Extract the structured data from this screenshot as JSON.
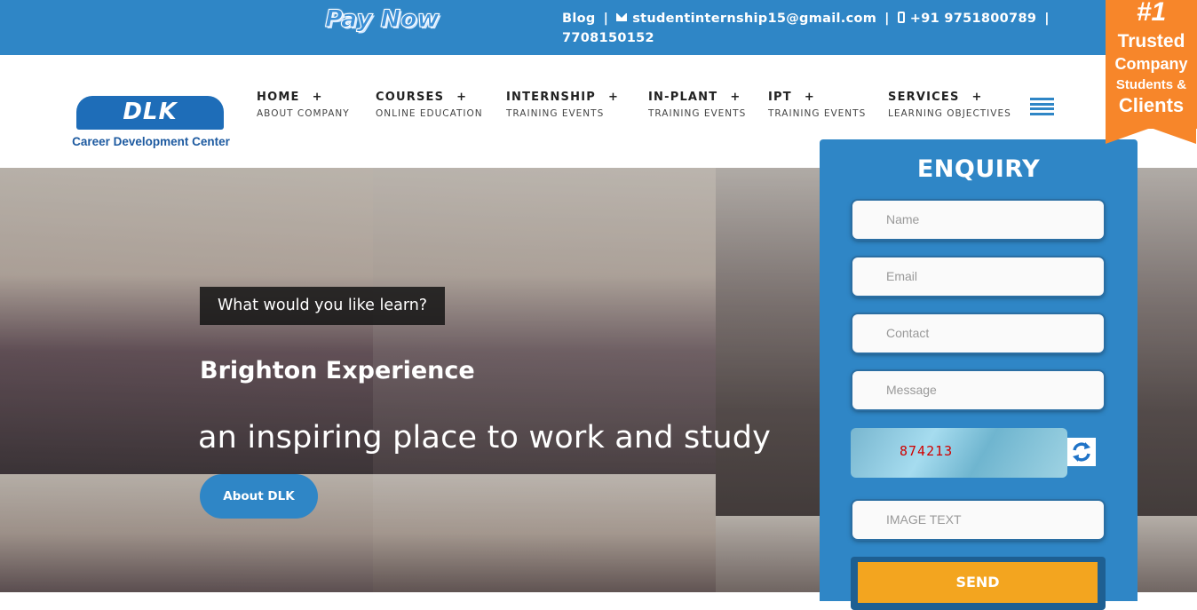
{
  "topbar": {
    "pay_now": "Pay Now",
    "blog": "Blog",
    "email": "studentinternship15@gmail.com",
    "phone_1": "+91 9751800789",
    "phone_2": "7708150152"
  },
  "badge": {
    "rank": "#1",
    "line1": "Trusted",
    "line2": "Company",
    "line3": "Students &",
    "line4": "Clients"
  },
  "logo": {
    "mark": "DLK",
    "subtitle": "Career Development Center"
  },
  "nav": [
    {
      "label": "HOME",
      "sub": "ABOUT COMPANY"
    },
    {
      "label": "COURSES",
      "sub": "ONLINE EDUCATION"
    },
    {
      "label": "INTERNSHIP",
      "sub": "TRAINING EVENTS"
    },
    {
      "label": "IN-PLANT",
      "sub": "TRAINING EVENTS"
    },
    {
      "label": "IPT",
      "sub": "TRAINING EVENTS"
    },
    {
      "label": "SERVICES",
      "sub": "LEARNING OBJECTIVES"
    }
  ],
  "hero": {
    "question": "What would you like learn?",
    "title": "Brighton Experience",
    "tagline": "an inspiring place to work and study",
    "button": "About DLK"
  },
  "enquiry": {
    "title": "ENQUIRY",
    "name_placeholder": "Name",
    "email_placeholder": "Email",
    "contact_placeholder": "Contact",
    "message_placeholder": "Message",
    "captcha_code": "874213",
    "image_text_placeholder": "IMAGE TEXT",
    "send": "SEND"
  },
  "colors": {
    "primary_blue": "#2f86c6",
    "badge_orange": "#f7862a",
    "send_orange": "#f3a51f"
  }
}
